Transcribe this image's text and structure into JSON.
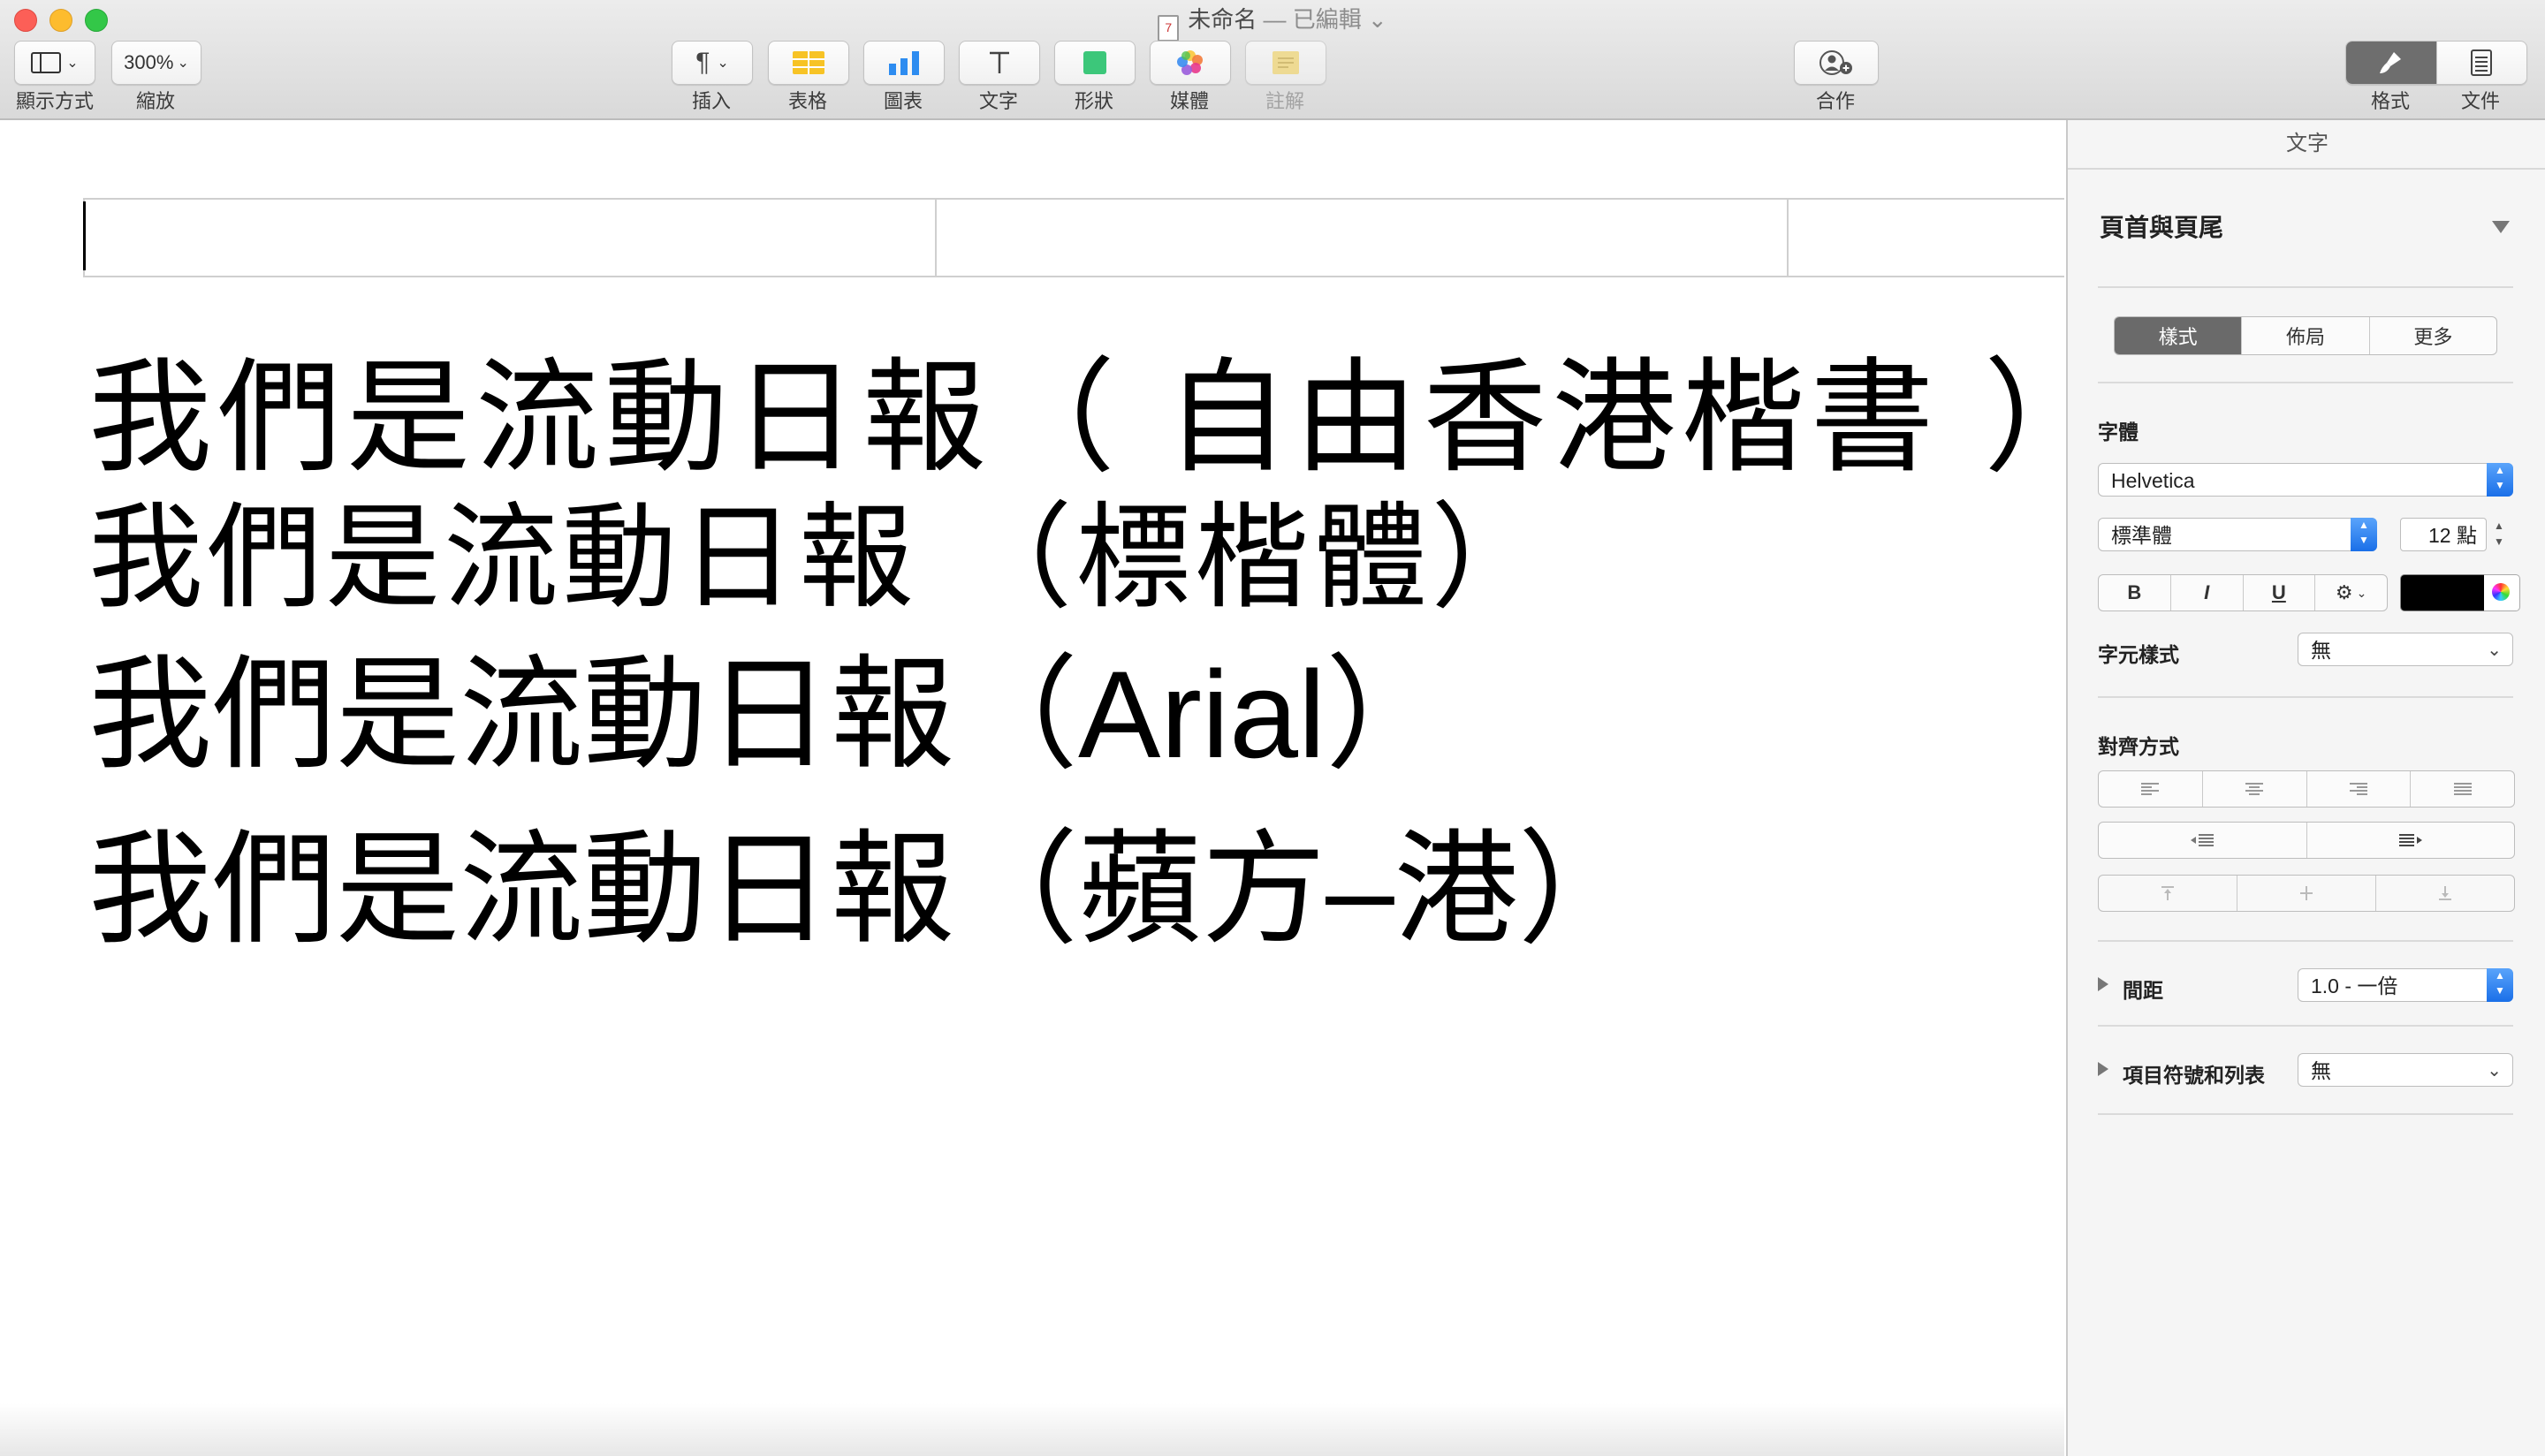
{
  "window": {
    "title": "未命名",
    "title_status": " — 已編輯 ⌄"
  },
  "toolbar": {
    "view_label": "顯示方式",
    "zoom_value": "300%",
    "zoom_label": "縮放",
    "insert_label": "插入",
    "table_label": "表格",
    "chart_label": "圖表",
    "text_label": "文字",
    "shape_label": "形狀",
    "media_label": "媒體",
    "comment_label": "註解",
    "collaborate_label": "合作",
    "format_label": "格式",
    "document_label": "文件"
  },
  "document": {
    "lines": [
      "我們是流動日報（ 自由香港楷書 ）",
      "我們是流動日報 （標楷體）",
      "我們是流動日報（Arial）",
      "我們是流動日報（蘋方–港）"
    ]
  },
  "inspector": {
    "tab": "文字",
    "section_title": "頁首與頁尾",
    "segments": [
      "樣式",
      "佈局",
      "更多"
    ],
    "font_label": "字體",
    "font_name": "Helvetica",
    "font_style": "標準體",
    "font_size": "12 點",
    "bold": "B",
    "italic": "I",
    "underline": "U",
    "gear": "⚙",
    "char_style_label": "字元樣式",
    "char_style_value": "無",
    "alignment_label": "對齊方式",
    "spacing_label": "間距",
    "spacing_value": "1.0 - 一倍",
    "bullets_label": "項目符號和列表",
    "bullets_value": "無"
  }
}
